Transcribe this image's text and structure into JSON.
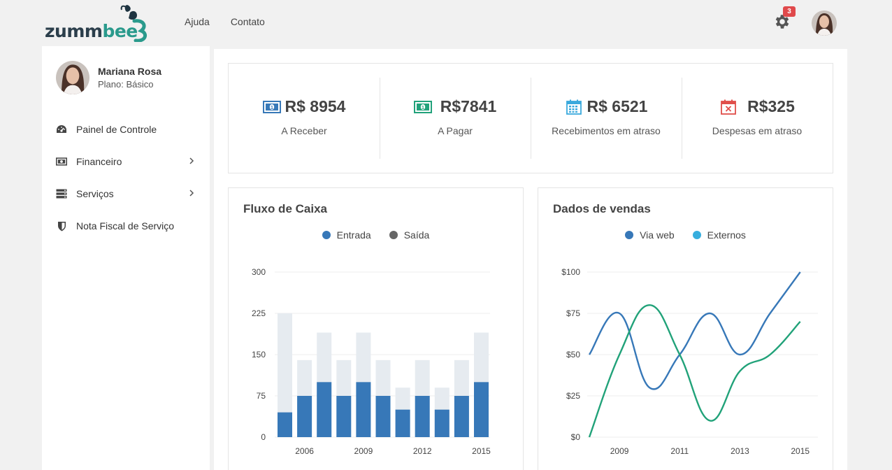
{
  "app": {
    "logo_text_a": "zumm",
    "logo_text_b": "bee"
  },
  "topnav": [
    {
      "label": "Ajuda"
    },
    {
      "label": "Contato"
    }
  ],
  "notifications": {
    "count": "3",
    "icon": "gear-icon"
  },
  "user": {
    "name": "Mariana Rosa",
    "plan": "Plano: Básico"
  },
  "sidebar": {
    "items": [
      {
        "label": "Painel de Controle",
        "icon": "dashboard-icon",
        "has_submenu": false
      },
      {
        "label": "Financeiro",
        "icon": "money-icon",
        "has_submenu": true
      },
      {
        "label": "Serviços",
        "icon": "server-icon",
        "has_submenu": true
      },
      {
        "label": "Nota Fiscal de Serviço",
        "icon": "shield-icon",
        "has_submenu": false
      }
    ]
  },
  "stats": [
    {
      "value": "R$ 8954",
      "label": "A Receber",
      "icon": "money-icon",
      "color": "#3879b8"
    },
    {
      "value": "R$7841",
      "label": "A Pagar",
      "icon": "money-icon",
      "color": "#22a27b"
    },
    {
      "value": "R$ 6521",
      "label": "Recebimentos em atraso",
      "icon": "calendar-icon",
      "color": "#3aa9dc"
    },
    {
      "value": "R$325",
      "label": "Despesas em atraso",
      "icon": "calendar-x-icon",
      "color": "#e04e4a"
    }
  ],
  "colors": {
    "blue": "#3778b8",
    "light": "#e6ebf0",
    "green": "#21a279",
    "cyan": "#37aede",
    "grey": "#666666"
  },
  "chart_data": [
    {
      "type": "bar",
      "title": "Fluxo de Caixa",
      "stacked": true,
      "categories": [
        "2005",
        "2006",
        "2007",
        "2008",
        "2009",
        "2010",
        "2011",
        "2012",
        "2013",
        "2014",
        "2015"
      ],
      "tick_labels": [
        "2006",
        "2009",
        "2012",
        "2015"
      ],
      "series": [
        {
          "name": "Entrada",
          "color": "#3778b8",
          "values": [
            45,
            75,
            100,
            75,
            100,
            75,
            50,
            75,
            50,
            75,
            100
          ]
        },
        {
          "name": "Saída",
          "color": "#e6ebf0",
          "values": [
            225,
            140,
            190,
            140,
            190,
            140,
            90,
            140,
            90,
            140,
            190
          ]
        }
      ],
      "legend_colors": [
        "#3778b8",
        "#666666"
      ],
      "yticks": [
        "0",
        "75",
        "150",
        "225",
        "300"
      ],
      "ylim": [
        0,
        300
      ],
      "legend": "top-center",
      "grid": true
    },
    {
      "type": "line",
      "title": "Dados de vendas",
      "x": [
        2008,
        2009,
        2010,
        2011,
        2012,
        2013,
        2014,
        2015
      ],
      "tick_labels": [
        "2009",
        "2011",
        "2013",
        "2015"
      ],
      "series": [
        {
          "name": "Via web",
          "color": "#3778b8",
          "values": [
            50,
            75,
            30,
            50,
            75,
            50,
            75,
            100
          ]
        },
        {
          "name": "Externos",
          "color": "#21a279",
          "values": [
            0,
            50,
            80,
            50,
            10,
            40,
            50,
            70
          ]
        }
      ],
      "legend_colors": [
        "#3778b8",
        "#37aede"
      ],
      "yticks": [
        "$0",
        "$25",
        "$50",
        "$75",
        "$100"
      ],
      "ylim": [
        0,
        100
      ],
      "legend": "top-center",
      "grid": true
    }
  ]
}
